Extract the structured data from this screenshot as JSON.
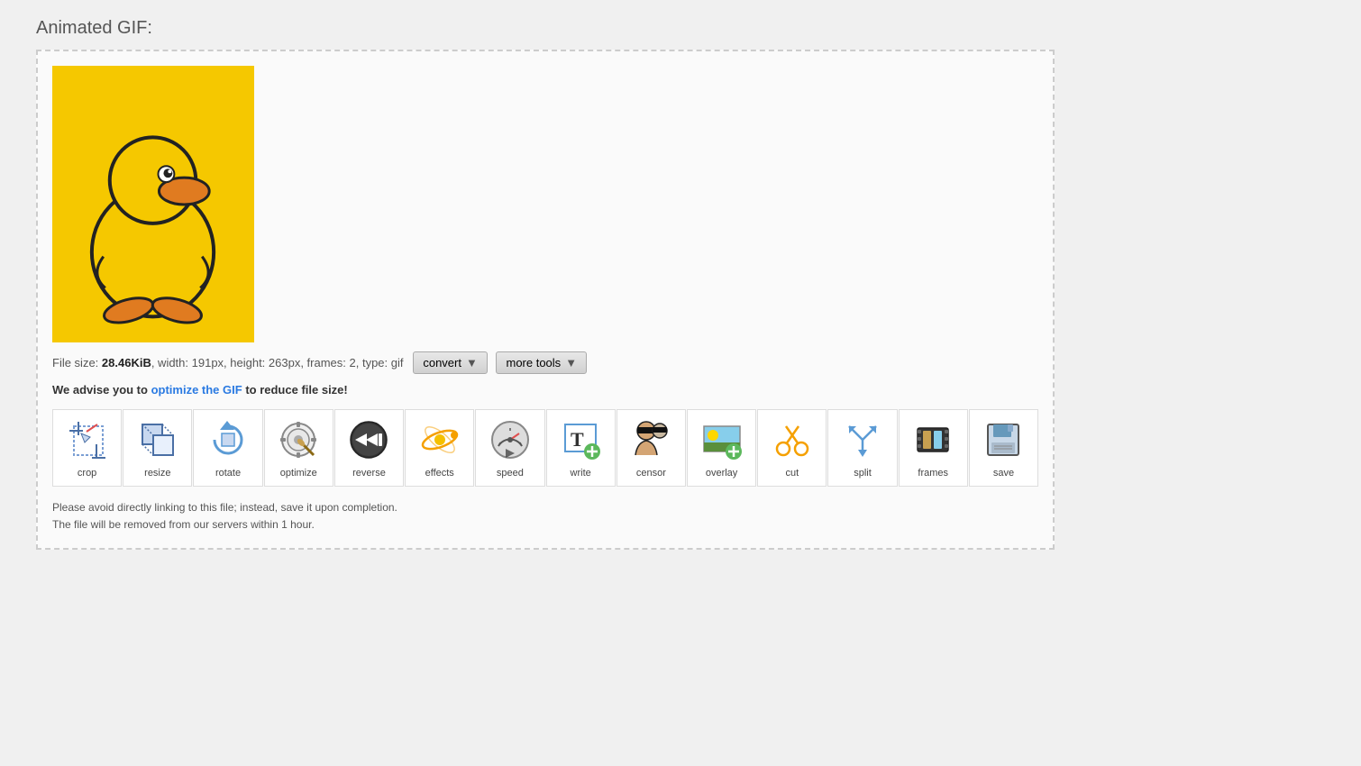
{
  "page": {
    "title": "Animated GIF:"
  },
  "file_info": {
    "label": "File size: ",
    "size": "28.46KiB",
    "rest": ", width: 191px, height: 263px, frames: 2, type: gif"
  },
  "buttons": {
    "convert": "convert",
    "more_tools": "more tools"
  },
  "advise": {
    "prefix": "We advise you to ",
    "link_text": "optimize the GIF",
    "suffix": " to reduce file size!"
  },
  "tools": [
    {
      "id": "crop",
      "label": "crop"
    },
    {
      "id": "resize",
      "label": "resize"
    },
    {
      "id": "rotate",
      "label": "rotate"
    },
    {
      "id": "optimize",
      "label": "optimize"
    },
    {
      "id": "reverse",
      "label": "reverse"
    },
    {
      "id": "effects",
      "label": "effects"
    },
    {
      "id": "speed",
      "label": "speed"
    },
    {
      "id": "write",
      "label": "write"
    },
    {
      "id": "censor",
      "label": "censor"
    },
    {
      "id": "overlay",
      "label": "overlay"
    },
    {
      "id": "cut",
      "label": "cut"
    },
    {
      "id": "split",
      "label": "split"
    },
    {
      "id": "frames",
      "label": "frames"
    },
    {
      "id": "save",
      "label": "save"
    }
  ],
  "notice": {
    "line1": "Please avoid directly linking to this file; instead, save it upon completion.",
    "line2": "The file will be removed from our servers within 1 hour."
  }
}
